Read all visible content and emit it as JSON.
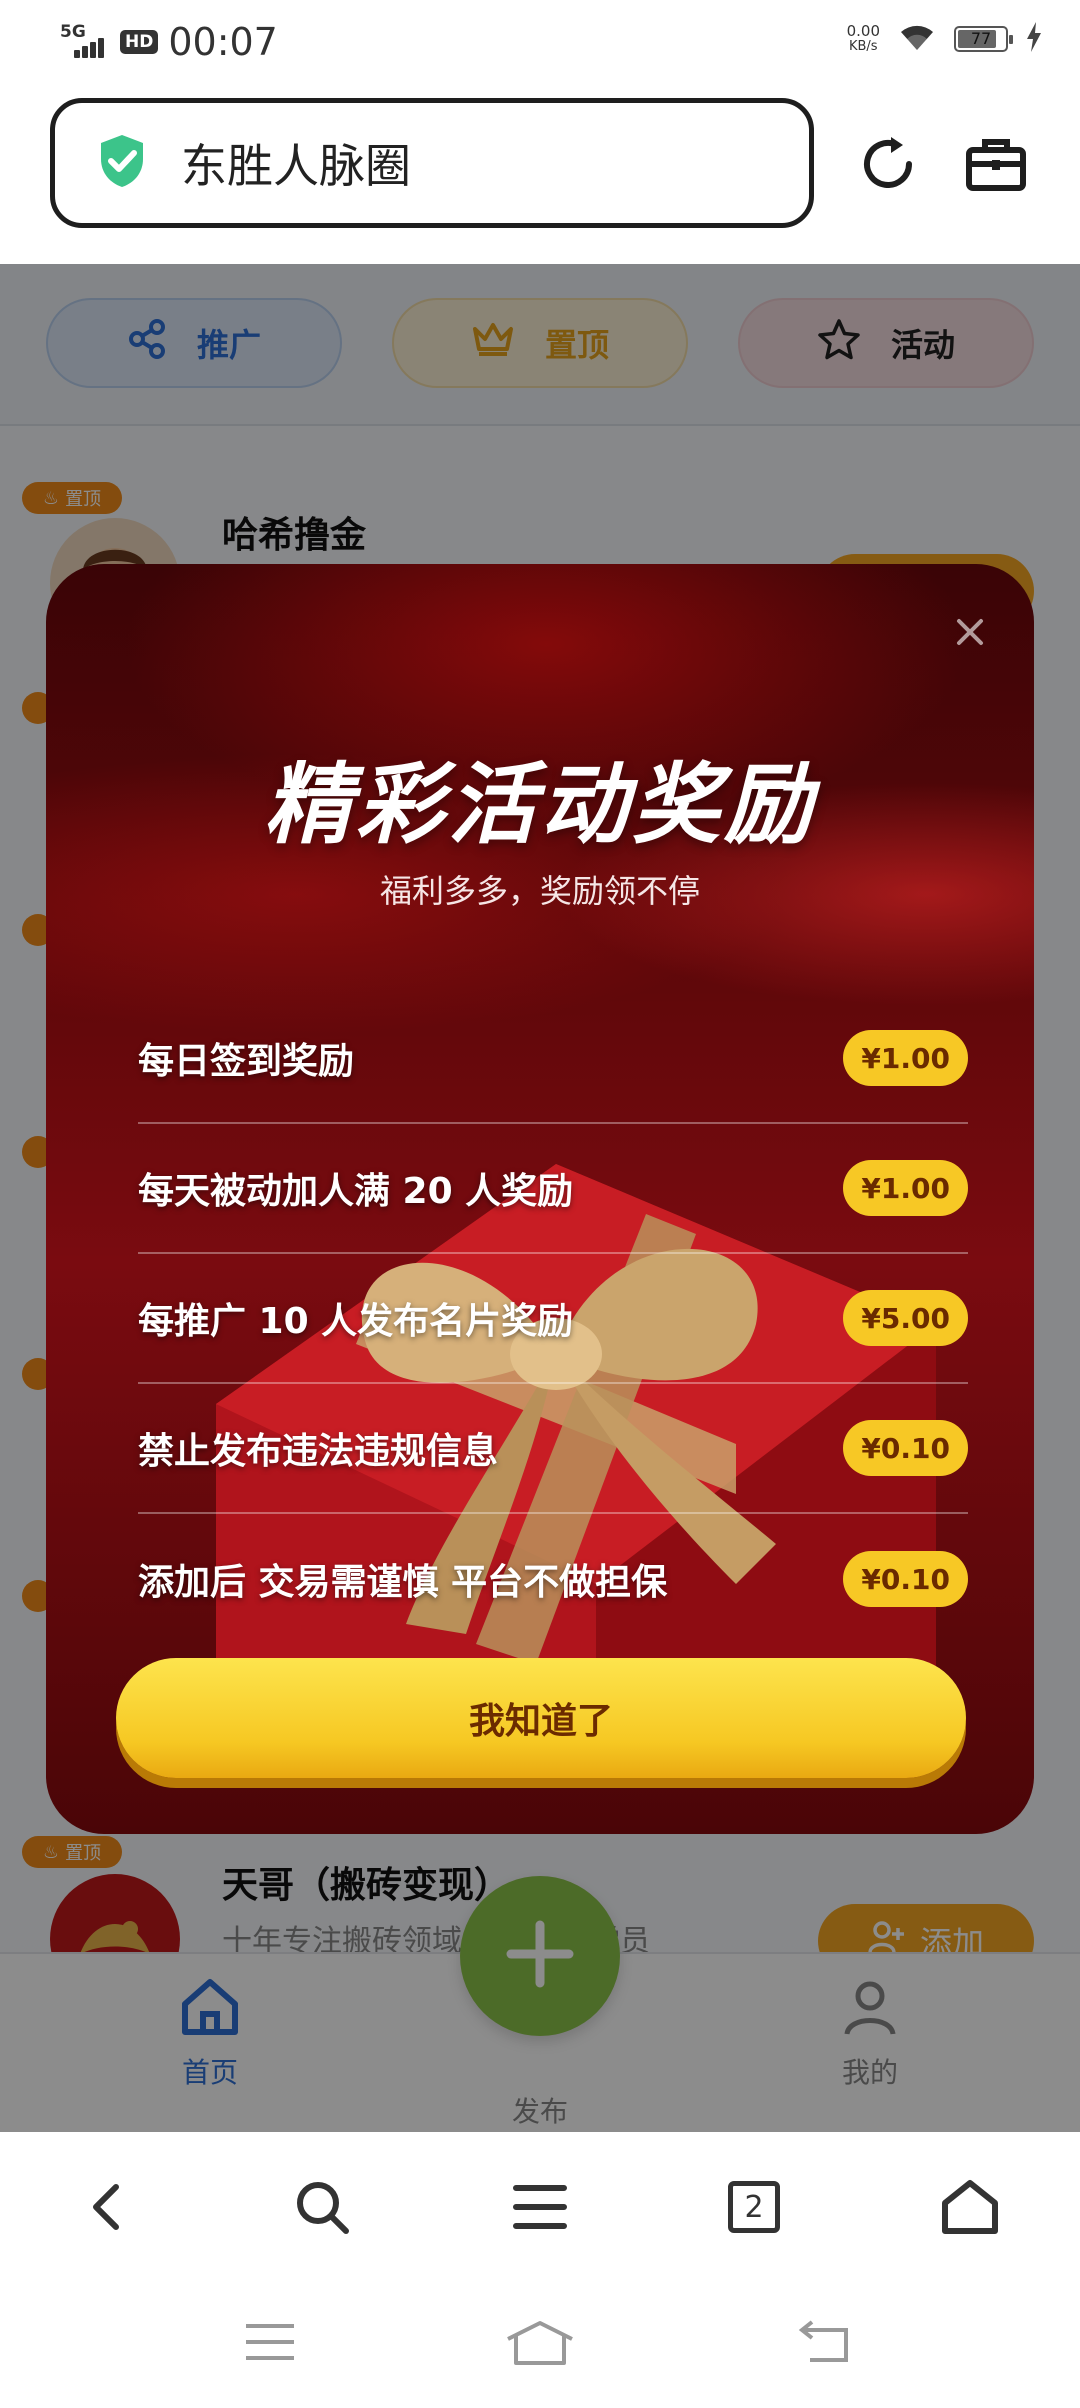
{
  "status_bar": {
    "network": "5G",
    "hd": "HD",
    "time": "00:07",
    "speed_value": "0.00",
    "speed_unit": "KB/s",
    "battery": "77"
  },
  "address_bar": {
    "title": "东胜人脉圈"
  },
  "top_tabs": [
    {
      "label": "推广",
      "color": "#2f6fd6"
    },
    {
      "label": "置顶",
      "color": "#e6a21c"
    },
    {
      "label": "活动",
      "color": "#222222"
    }
  ],
  "list": {
    "pin_label": "置顶",
    "items": [
      {
        "name": "哈希撸金"
      },
      {
        "name": "天哥（搬砖变现）",
        "desc": "十年专注搬砖领域……00名学员",
        "add_label": "添加"
      }
    ]
  },
  "bottom_nav": {
    "home": "首页",
    "publish": "发布",
    "mine": "我的"
  },
  "modal": {
    "title": "精彩活动奖励",
    "subtitle": "福利多多，奖励领不停",
    "rewards": [
      {
        "label": "每日签到奖励",
        "amount": "¥1.00"
      },
      {
        "label": "每天被动加人满 20 人奖励",
        "amount": "¥1.00"
      },
      {
        "label": "每推广 10 人发布名片奖励",
        "amount": "¥5.00"
      },
      {
        "label": "禁止发布违法违规信息",
        "amount": "¥0.10"
      },
      {
        "label": "添加后 交易需谨慎 平台不做担保",
        "amount": "¥0.10"
      }
    ],
    "confirm": "我知道了"
  },
  "browser_toolbar": {
    "tab_count": "2"
  },
  "colors": {
    "accent_blue": "#2f6fd6",
    "gold": "#f7c825",
    "modal_red": "#7a0b10",
    "publish_green": "#8bc34a"
  }
}
